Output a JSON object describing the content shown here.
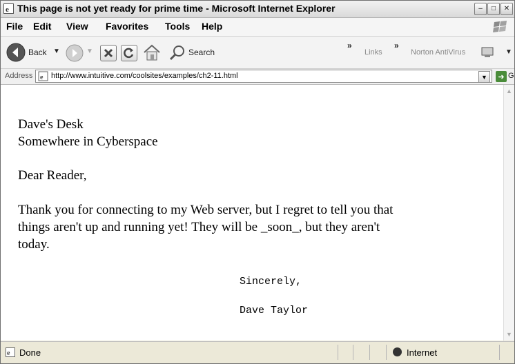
{
  "window": {
    "title": "This page is not yet ready for prime time - Microsoft Internet Explorer"
  },
  "menu": [
    "File",
    "Edit",
    "View",
    "Favorites",
    "Tools",
    "Help"
  ],
  "toolbar": {
    "back_label": "Back",
    "search_label": "Search",
    "chevron": "»",
    "links_label": "Links",
    "norton_label": "Norton AntiVirus"
  },
  "address": {
    "label": "Address",
    "url": "http://www.intuitive.com/coolsites/examples/ch2-11.html",
    "go_label": "Go"
  },
  "page": {
    "line1": "Dave's Desk",
    "line2": "Somewhere in Cyberspace",
    "salutation": "Dear Reader,",
    "body_line1": "Thank you for connecting to my Web server, but I regret to tell you that",
    "body_line2": "things aren't up and running yet! They will be _soon_, but they aren't",
    "body_line3": "today.",
    "closing": "Sincerely,",
    "signature": "Dave Taylor"
  },
  "status": {
    "left": "Done",
    "zone": "Internet"
  }
}
